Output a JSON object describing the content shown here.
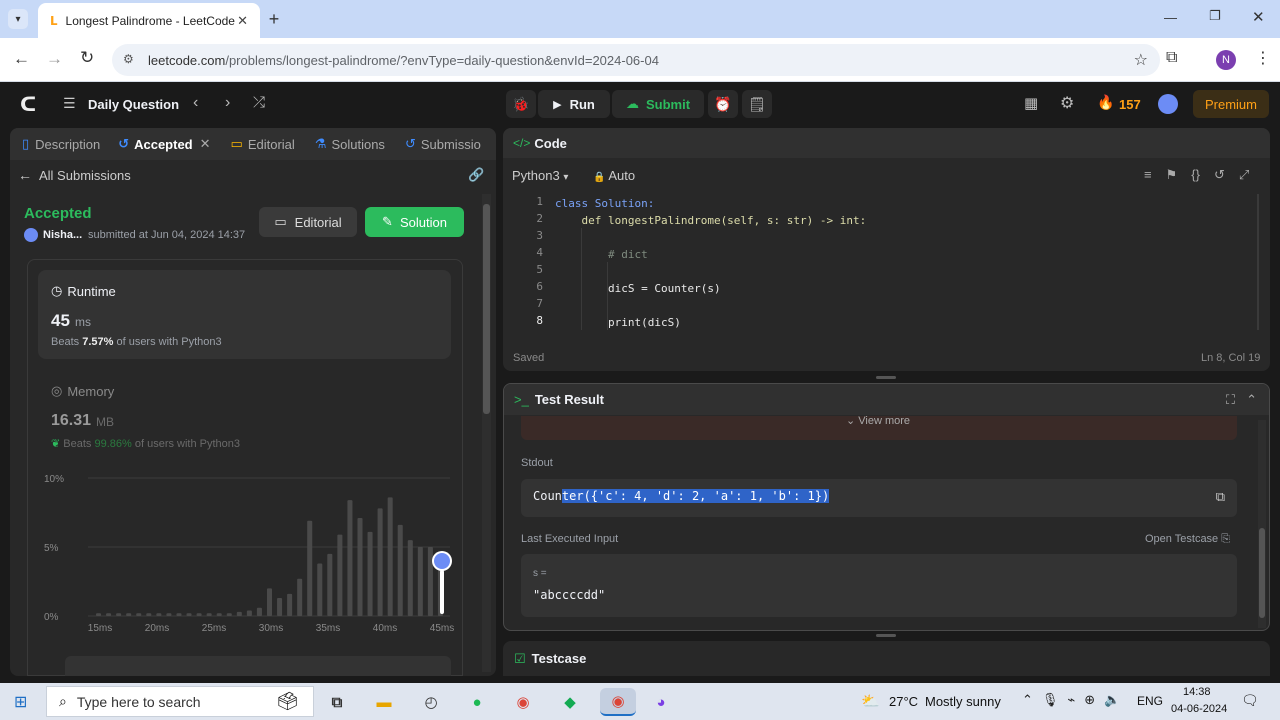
{
  "browser": {
    "tab_title": "Longest Palindrome - LeetCode",
    "url_host": "leetcode.com",
    "url_path": "/problems/longest-palindrome/?envType=daily-question&envId=2024-06-04",
    "profile_initial": "N"
  },
  "topbar": {
    "daily_label": "Daily Question",
    "run_label": "Run",
    "submit_label": "Submit",
    "streak": "157",
    "premium_label": "Premium"
  },
  "left": {
    "tabs": [
      "Description",
      "Accepted",
      "Editorial",
      "Solutions",
      "Submissio"
    ],
    "back_label": "All Submissions",
    "status": "Accepted",
    "user": "Nisha...",
    "submitted": "submitted at Jun 04, 2024 14:37",
    "editorial_btn": "Editorial",
    "solution_btn": "Solution",
    "runtime": {
      "title": "Runtime",
      "value": "45",
      "unit": "ms",
      "beats_prefix": "Beats",
      "beats": "7.57%",
      "beats_suffix": "of users with Python3"
    },
    "memory": {
      "title": "Memory",
      "value": "16.31",
      "unit": "MB",
      "beats_prefix": "Beats",
      "beats": "99.86%",
      "beats_suffix": "of users with Python3"
    }
  },
  "chart_data": {
    "type": "bar",
    "x_ticks": [
      "15ms",
      "20ms",
      "25ms",
      "30ms",
      "35ms",
      "40ms",
      "45ms"
    ],
    "y_ticks": [
      "10%",
      "5%",
      "0%"
    ],
    "ylim": [
      0,
      10
    ],
    "values": [
      0.2,
      0.2,
      0.2,
      0.2,
      0.2,
      0.2,
      0.2,
      0.2,
      0.2,
      0.2,
      0.2,
      0.2,
      0.2,
      0.2,
      0.3,
      0.4,
      0.6,
      2.0,
      1.3,
      1.6,
      2.7,
      6.9,
      3.8,
      4.5,
      5.9,
      8.4,
      7.1,
      6.1,
      7.8,
      8.6,
      6.6,
      5.5,
      5.0,
      5.0,
      3.3
    ],
    "grid": true,
    "marker": "45ms"
  },
  "code": {
    "title": "Code",
    "language": "Python3",
    "mode": "Auto",
    "lines": [
      {
        "n": "1",
        "t": "class Solution:"
      },
      {
        "n": "2",
        "t": "    def longestPalindrome(self, s: str) -> int:"
      },
      {
        "n": "3",
        "t": ""
      },
      {
        "n": "4",
        "t": "        # dict"
      },
      {
        "n": "5",
        "t": ""
      },
      {
        "n": "6",
        "t": "        dicS = Counter(s)"
      },
      {
        "n": "7",
        "t": ""
      },
      {
        "n": "8",
        "t": "        print(dicS)"
      }
    ],
    "saved": "Saved",
    "cursor": "Ln 8, Col 19"
  },
  "result": {
    "title": "Test Result",
    "view_more": "View more",
    "stdout_label": "Stdout",
    "stdout_plain": "Coun",
    "stdout_sel": "ter({'c': 4, 'd': 2, 'a': 1, 'b': 1})",
    "last_input_label": "Last Executed Input",
    "open_testcase": "Open Testcase",
    "input_var": "s =",
    "input_val": "\"abccccdd\""
  },
  "testcase_label": "Testcase",
  "taskbar": {
    "search": "Type here to search",
    "temp": "27°C",
    "weather": "Mostly sunny",
    "lang": "ENG",
    "time": "14:38",
    "date": "04-06-2024"
  }
}
